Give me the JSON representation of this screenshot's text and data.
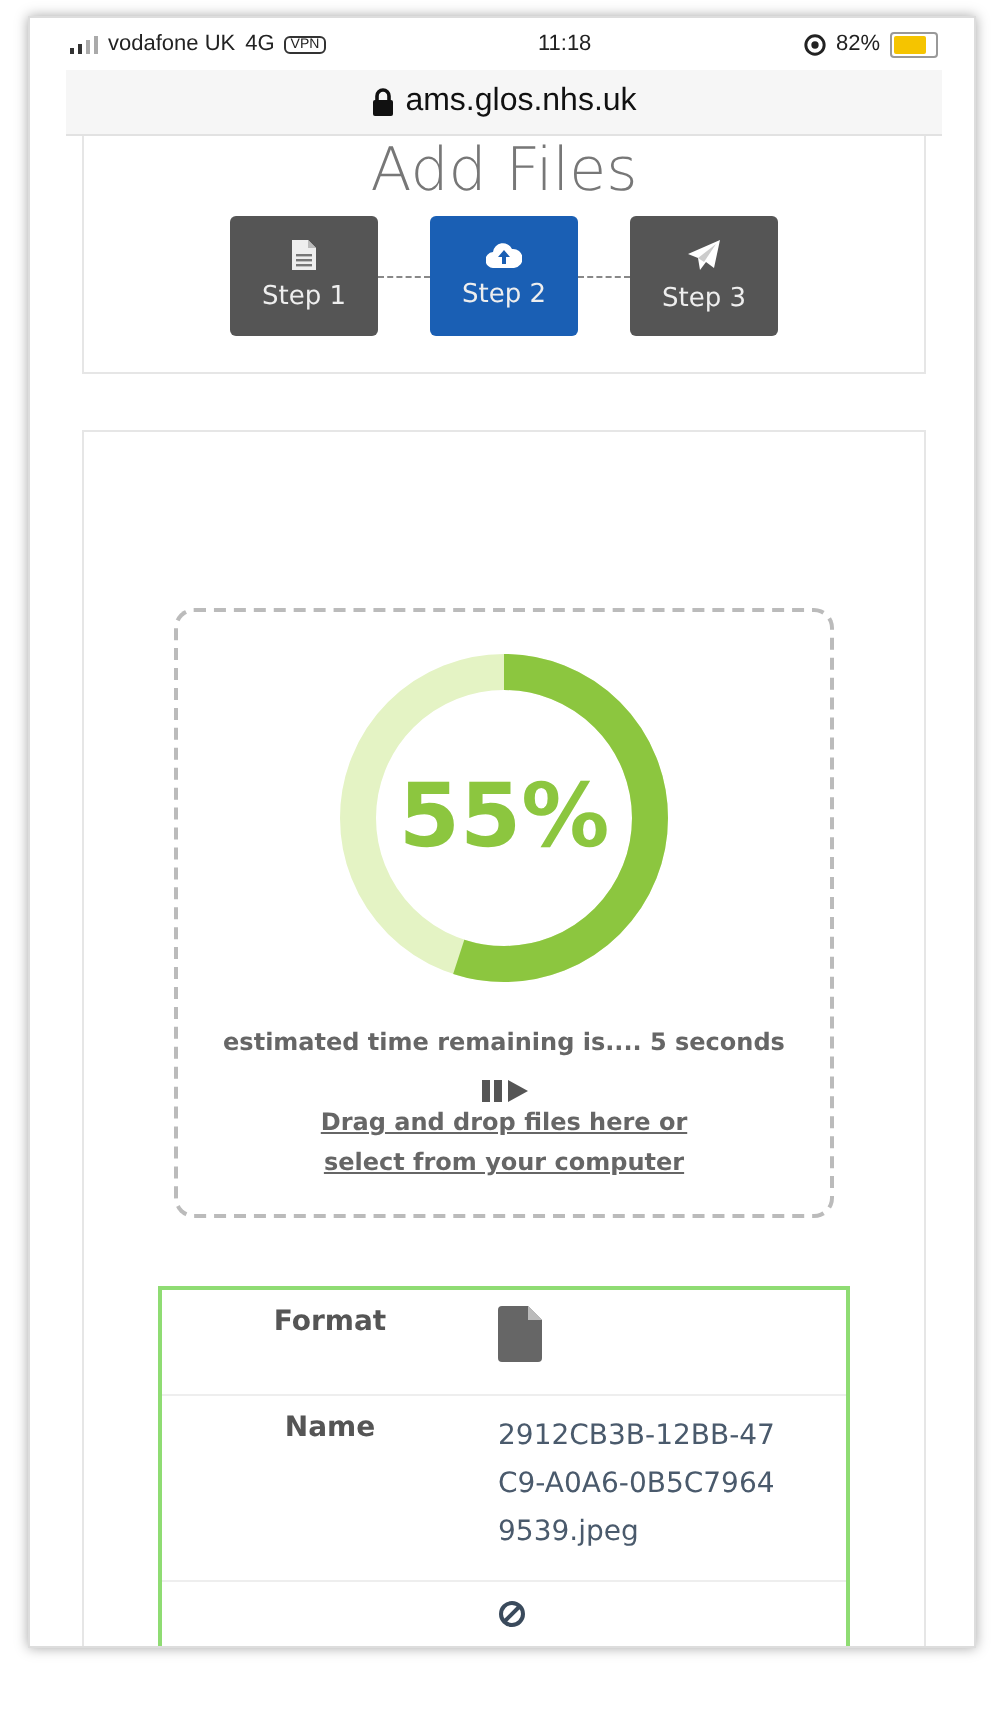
{
  "status_bar": {
    "carrier": "vodafone UK",
    "network": "4G",
    "vpn": "VPN",
    "time": "11:18",
    "battery": "82%"
  },
  "address_bar": {
    "url": "ams.glos.nhs.uk"
  },
  "header": {
    "title": "Add Files",
    "steps": [
      {
        "label": "Step 1",
        "kind": "document",
        "selected": false
      },
      {
        "label": "Step 2",
        "kind": "upload",
        "selected": true
      },
      {
        "label": "Step 3",
        "kind": "send",
        "selected": false
      }
    ]
  },
  "upload": {
    "progress": {
      "label": "55%",
      "level": 0.55
    },
    "eta": "estimated time remaining is.... 5 seconds",
    "drop_text": "Drag and drop files here or select from your computer"
  },
  "file_table": {
    "rows": [
      {
        "label": "Format",
        "kind": "file-icon"
      },
      {
        "label": "Name",
        "kind": "text",
        "value": "2912CB3B-12BB-47C9-A0A6-0B5C79649539.jpeg"
      },
      {
        "kind": "blocked-icon"
      }
    ]
  }
}
